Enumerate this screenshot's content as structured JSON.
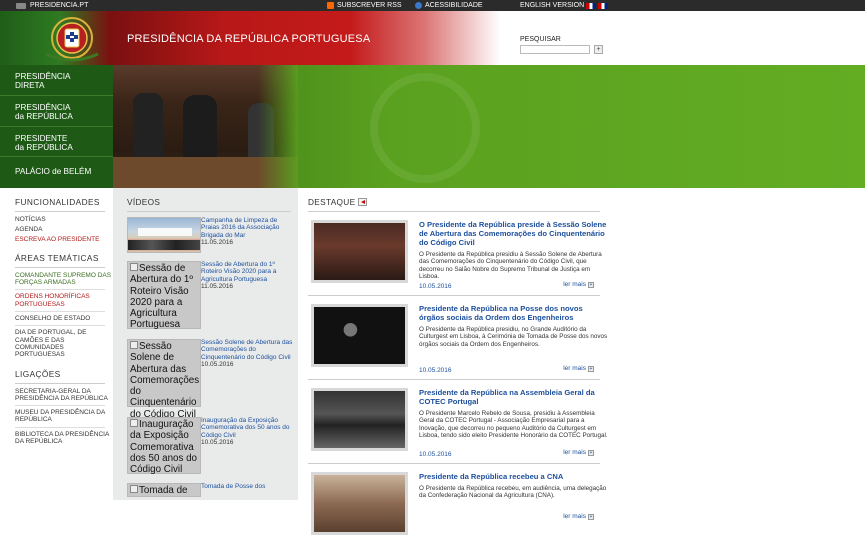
{
  "topbar": {
    "site": "PRESIDENCIA.PT",
    "rss": "SUBSCREVER RSS",
    "accessibility": "ACESSIBILIDADE",
    "english": "ENGLISH VERSION"
  },
  "header": {
    "title": "PRESIDÊNCIA DA REPÚBLICA PORTUGUESA"
  },
  "search": {
    "label": "PESQUISAR",
    "button": "+",
    "value": ""
  },
  "mainnav": [
    {
      "line1": "PRESIDÊNCIA",
      "line2": "DIRETA"
    },
    {
      "line1": "PRESIDÊNCIA",
      "line2": "da REPÚBLICA"
    },
    {
      "line1": "PRESIDENTE",
      "line2": "da REPÚBLICA"
    },
    {
      "line1": "PALÁCIO de BELÉM",
      "line2": ""
    }
  ],
  "funcionalidades": {
    "heading": "FUNCIONALIDADES",
    "links": [
      "NOTÍCIAS",
      "AGENDA",
      "ESCREVA AO PRESIDENTE"
    ]
  },
  "areas": {
    "heading": "ÁREAS TEMÁTICAS",
    "links": [
      "COMANDANTE SUPREMO DAS FORÇAS ARMADAS",
      "ORDENS HONORÍFICAS PORTUGUESAS",
      "CONSELHO DE ESTADO",
      "DIA DE PORTUGAL, DE CAMÕES E DAS COMUNIDADES PORTUGUESAS"
    ]
  },
  "ligacoes": {
    "heading": "LIGAÇÕES",
    "links": [
      "SECRETARIA-GERAL DA PRESIDÊNCIA DA REPÚBLICA",
      "MUSEU DA PRESIDÊNCIA DA REPÚBLICA",
      "BIBLIOTECA DA PRESIDÊNCIA DA REPÚBLICA"
    ]
  },
  "videos": {
    "heading": "VÍDEOS",
    "items": [
      {
        "alt": "",
        "title": "Campanha de Limpeza de Praias 2016 da Associação Brigada do Mar",
        "date": "11.05.2016"
      },
      {
        "alt": "Sessão de Abertura do 1º Roteiro Visão 2020 para a Agricultura Portuguesa",
        "title": "Sessão de Abertura do 1º Roteiro Visão 2020 para a Agricultura Portuguesa",
        "date": "11.05.2016"
      },
      {
        "alt": "Sessão Solene de Abertura das Comemorações do Cinquentenário do Código Civil",
        "title": "Sessão Solene de Abertura das Comemorações do Cinquentenário do Código Civil",
        "date": "10.05.2016"
      },
      {
        "alt": "Inauguração da Exposição Comemorativa dos 50 anos do Código Civil",
        "title": "Inauguração da Exposição Comemorativa dos 50 anos do Código Civil",
        "date": "10.05.2016"
      },
      {
        "alt": "Tomada de Posse dos",
        "title": "Tomada de Posse dos",
        "date": ""
      }
    ]
  },
  "destaque": {
    "heading": "DESTAQUE",
    "more": "ler mais",
    "items": [
      {
        "title": "O Presidente da República preside à Sessão Solene de Abertura das Comemorações do Cinquentenário do Código Civil",
        "text": "O Presidente da República presidiu à Sessão Solene de Abertura das Comemorações do Cinquentenário do Código Civil, que decorreu no Salão Nobre do Supremo Tribunal de Justiça em Lisboa.",
        "date": "10.05.2016"
      },
      {
        "title": "Presidente da República na Posse dos novos órgãos sociais da Ordem dos Engenheiros",
        "text": "O Presidente da República presidiu, no Grande Auditório da Culturgest em Lisboa, à Cerimónia de Tomada de Posse dos novos órgãos sociais da Ordem dos Engenheiros.",
        "date": "10.05.2016"
      },
      {
        "title": "Presidente da República na Assembleia Geral da COTEC Portugal",
        "text": "O Presidente Marcelo Rebelo de Sousa, presidiu à Assembleia Geral da COTEC Portugal - Associação Empresarial para a Inovação, que decorreu no pequeno Auditório da Culturgest em Lisboa, tendo sido eleito Presidente Honorário da COTEC Portugal.",
        "date": "10.05.2016"
      },
      {
        "title": "Presidente da República recebeu a CNA",
        "text": "O Presidente da República recebeu, em audiência, uma delegação da Confederação Nacional da Agricultura (CNA).",
        "date": ""
      }
    ]
  },
  "colors": {
    "nav_green": "#1e5a16",
    "header_red": "#c41a1a",
    "link_blue": "#1c4f9c",
    "alert_red": "#b01818"
  }
}
